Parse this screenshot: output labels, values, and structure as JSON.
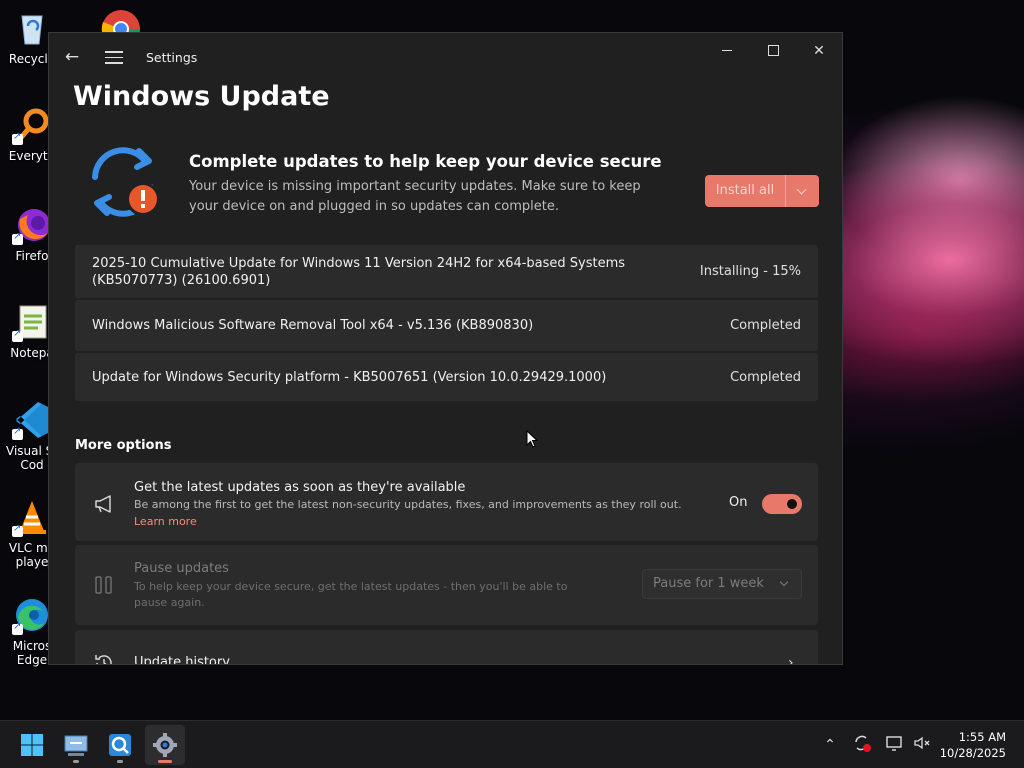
{
  "desktop": {
    "icons": [
      {
        "label": "Recycle",
        "icon": "recycle-bin-icon"
      },
      {
        "label": "Everyth",
        "icon": "everything-search-icon"
      },
      {
        "label": "Firefo",
        "icon": "firefox-icon"
      },
      {
        "label": "Notepa",
        "icon": "notepad-plus-plus-icon"
      },
      {
        "label": "Visual St",
        "label2": "Cod",
        "icon": "vscode-icon"
      },
      {
        "label": "VLC me",
        "label2": "playe",
        "icon": "vlc-icon"
      },
      {
        "label": "Micros",
        "label2": "Edge",
        "icon": "edge-icon"
      }
    ]
  },
  "window": {
    "title": "Settings",
    "page_title": "Windows Update"
  },
  "banner": {
    "title": "Complete updates to help keep your device secure",
    "description": "Your device is missing important security updates. Make sure to keep your device on and plugged in so updates can complete.",
    "install_button": "Install all"
  },
  "updates": [
    {
      "name": "2025-10 Cumulative Update for Windows 11 Version 24H2 for x64-based Systems (KB5070773) (26100.6901)",
      "status": "Installing - 15%"
    },
    {
      "name": "Windows Malicious Software Removal Tool x64 - v5.136 (KB890830)",
      "status": "Completed"
    },
    {
      "name": "Update for Windows Security platform - KB5007651 (Version 10.0.29429.1000)",
      "status": "Completed"
    }
  ],
  "more_options": {
    "heading": "More options",
    "latest_updates": {
      "title": "Get the latest updates as soon as they're available",
      "description": "Be among the first to get the latest non-security updates, fixes, and improvements as they roll out.",
      "link": "Learn more",
      "toggle_label": "On",
      "toggle_on": true
    },
    "pause_updates": {
      "title": "Pause updates",
      "description": "To help keep your device secure, get the latest updates - then you'll be able to pause again.",
      "select_value": "Pause for 1 week"
    },
    "update_history": {
      "title": "Update history"
    }
  },
  "taskbar": {
    "time": "1:55 AM",
    "date": "10/28/2025"
  },
  "colors": {
    "accent": "#e8796a",
    "window_bg": "#202020",
    "card_bg": "#2b2b2b",
    "sync_icon": "#3a8ee6",
    "warning_badge": "#e8572a"
  }
}
